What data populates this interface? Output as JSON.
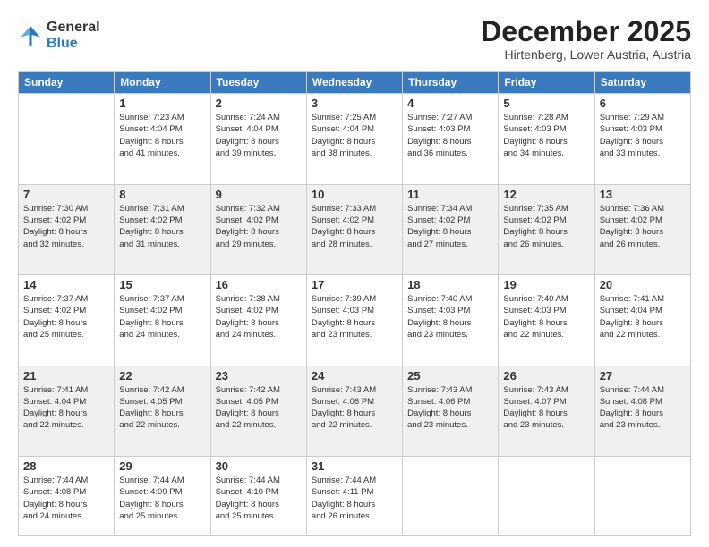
{
  "logo": {
    "general": "General",
    "blue": "Blue"
  },
  "title": "December 2025",
  "subtitle": "Hirtenberg, Lower Austria, Austria",
  "days_of_week": [
    "Sunday",
    "Monday",
    "Tuesday",
    "Wednesday",
    "Thursday",
    "Friday",
    "Saturday"
  ],
  "weeks": [
    [
      {
        "day": "",
        "info": ""
      },
      {
        "day": "1",
        "info": "Sunrise: 7:23 AM\nSunset: 4:04 PM\nDaylight: 8 hours\nand 41 minutes."
      },
      {
        "day": "2",
        "info": "Sunrise: 7:24 AM\nSunset: 4:04 PM\nDaylight: 8 hours\nand 39 minutes."
      },
      {
        "day": "3",
        "info": "Sunrise: 7:25 AM\nSunset: 4:04 PM\nDaylight: 8 hours\nand 38 minutes."
      },
      {
        "day": "4",
        "info": "Sunrise: 7:27 AM\nSunset: 4:03 PM\nDaylight: 8 hours\nand 36 minutes."
      },
      {
        "day": "5",
        "info": "Sunrise: 7:28 AM\nSunset: 4:03 PM\nDaylight: 8 hours\nand 34 minutes."
      },
      {
        "day": "6",
        "info": "Sunrise: 7:29 AM\nSunset: 4:03 PM\nDaylight: 8 hours\nand 33 minutes."
      }
    ],
    [
      {
        "day": "7",
        "info": "Sunrise: 7:30 AM\nSunset: 4:02 PM\nDaylight: 8 hours\nand 32 minutes."
      },
      {
        "day": "8",
        "info": "Sunrise: 7:31 AM\nSunset: 4:02 PM\nDaylight: 8 hours\nand 31 minutes."
      },
      {
        "day": "9",
        "info": "Sunrise: 7:32 AM\nSunset: 4:02 PM\nDaylight: 8 hours\nand 29 minutes."
      },
      {
        "day": "10",
        "info": "Sunrise: 7:33 AM\nSunset: 4:02 PM\nDaylight: 8 hours\nand 28 minutes."
      },
      {
        "day": "11",
        "info": "Sunrise: 7:34 AM\nSunset: 4:02 PM\nDaylight: 8 hours\nand 27 minutes."
      },
      {
        "day": "12",
        "info": "Sunrise: 7:35 AM\nSunset: 4:02 PM\nDaylight: 8 hours\nand 26 minutes."
      },
      {
        "day": "13",
        "info": "Sunrise: 7:36 AM\nSunset: 4:02 PM\nDaylight: 8 hours\nand 26 minutes."
      }
    ],
    [
      {
        "day": "14",
        "info": "Sunrise: 7:37 AM\nSunset: 4:02 PM\nDaylight: 8 hours\nand 25 minutes."
      },
      {
        "day": "15",
        "info": "Sunrise: 7:37 AM\nSunset: 4:02 PM\nDaylight: 8 hours\nand 24 minutes."
      },
      {
        "day": "16",
        "info": "Sunrise: 7:38 AM\nSunset: 4:02 PM\nDaylight: 8 hours\nand 24 minutes."
      },
      {
        "day": "17",
        "info": "Sunrise: 7:39 AM\nSunset: 4:03 PM\nDaylight: 8 hours\nand 23 minutes."
      },
      {
        "day": "18",
        "info": "Sunrise: 7:40 AM\nSunset: 4:03 PM\nDaylight: 8 hours\nand 23 minutes."
      },
      {
        "day": "19",
        "info": "Sunrise: 7:40 AM\nSunset: 4:03 PM\nDaylight: 8 hours\nand 22 minutes."
      },
      {
        "day": "20",
        "info": "Sunrise: 7:41 AM\nSunset: 4:04 PM\nDaylight: 8 hours\nand 22 minutes."
      }
    ],
    [
      {
        "day": "21",
        "info": "Sunrise: 7:41 AM\nSunset: 4:04 PM\nDaylight: 8 hours\nand 22 minutes."
      },
      {
        "day": "22",
        "info": "Sunrise: 7:42 AM\nSunset: 4:05 PM\nDaylight: 8 hours\nand 22 minutes."
      },
      {
        "day": "23",
        "info": "Sunrise: 7:42 AM\nSunset: 4:05 PM\nDaylight: 8 hours\nand 22 minutes."
      },
      {
        "day": "24",
        "info": "Sunrise: 7:43 AM\nSunset: 4:06 PM\nDaylight: 8 hours\nand 22 minutes."
      },
      {
        "day": "25",
        "info": "Sunrise: 7:43 AM\nSunset: 4:06 PM\nDaylight: 8 hours\nand 23 minutes."
      },
      {
        "day": "26",
        "info": "Sunrise: 7:43 AM\nSunset: 4:07 PM\nDaylight: 8 hours\nand 23 minutes."
      },
      {
        "day": "27",
        "info": "Sunrise: 7:44 AM\nSunset: 4:08 PM\nDaylight: 8 hours\nand 23 minutes."
      }
    ],
    [
      {
        "day": "28",
        "info": "Sunrise: 7:44 AM\nSunset: 4:08 PM\nDaylight: 8 hours\nand 24 minutes."
      },
      {
        "day": "29",
        "info": "Sunrise: 7:44 AM\nSunset: 4:09 PM\nDaylight: 8 hours\nand 25 minutes."
      },
      {
        "day": "30",
        "info": "Sunrise: 7:44 AM\nSunset: 4:10 PM\nDaylight: 8 hours\nand 25 minutes."
      },
      {
        "day": "31",
        "info": "Sunrise: 7:44 AM\nSunset: 4:11 PM\nDaylight: 8 hours\nand 26 minutes."
      },
      {
        "day": "",
        "info": ""
      },
      {
        "day": "",
        "info": ""
      },
      {
        "day": "",
        "info": ""
      }
    ]
  ]
}
